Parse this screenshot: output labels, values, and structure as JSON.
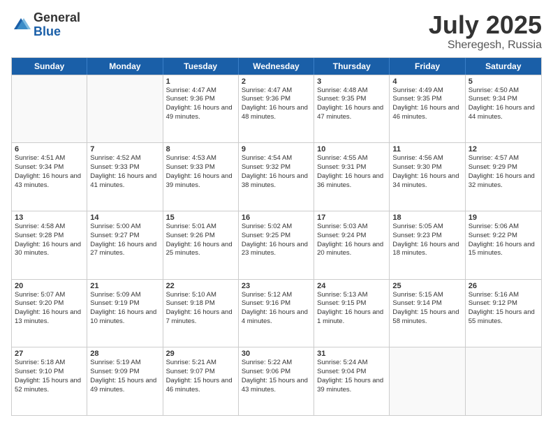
{
  "logo": {
    "general": "General",
    "blue": "Blue"
  },
  "title": "July 2025",
  "subtitle": "Sheregesh, Russia",
  "header_days": [
    "Sunday",
    "Monday",
    "Tuesday",
    "Wednesday",
    "Thursday",
    "Friday",
    "Saturday"
  ],
  "weeks": [
    [
      {
        "day": "",
        "empty": true
      },
      {
        "day": "",
        "empty": true
      },
      {
        "day": "1",
        "sunrise": "Sunrise: 4:47 AM",
        "sunset": "Sunset: 9:36 PM",
        "daylight": "Daylight: 16 hours and 49 minutes."
      },
      {
        "day": "2",
        "sunrise": "Sunrise: 4:47 AM",
        "sunset": "Sunset: 9:36 PM",
        "daylight": "Daylight: 16 hours and 48 minutes."
      },
      {
        "day": "3",
        "sunrise": "Sunrise: 4:48 AM",
        "sunset": "Sunset: 9:35 PM",
        "daylight": "Daylight: 16 hours and 47 minutes."
      },
      {
        "day": "4",
        "sunrise": "Sunrise: 4:49 AM",
        "sunset": "Sunset: 9:35 PM",
        "daylight": "Daylight: 16 hours and 46 minutes."
      },
      {
        "day": "5",
        "sunrise": "Sunrise: 4:50 AM",
        "sunset": "Sunset: 9:34 PM",
        "daylight": "Daylight: 16 hours and 44 minutes."
      }
    ],
    [
      {
        "day": "6",
        "sunrise": "Sunrise: 4:51 AM",
        "sunset": "Sunset: 9:34 PM",
        "daylight": "Daylight: 16 hours and 43 minutes."
      },
      {
        "day": "7",
        "sunrise": "Sunrise: 4:52 AM",
        "sunset": "Sunset: 9:33 PM",
        "daylight": "Daylight: 16 hours and 41 minutes."
      },
      {
        "day": "8",
        "sunrise": "Sunrise: 4:53 AM",
        "sunset": "Sunset: 9:33 PM",
        "daylight": "Daylight: 16 hours and 39 minutes."
      },
      {
        "day": "9",
        "sunrise": "Sunrise: 4:54 AM",
        "sunset": "Sunset: 9:32 PM",
        "daylight": "Daylight: 16 hours and 38 minutes."
      },
      {
        "day": "10",
        "sunrise": "Sunrise: 4:55 AM",
        "sunset": "Sunset: 9:31 PM",
        "daylight": "Daylight: 16 hours and 36 minutes."
      },
      {
        "day": "11",
        "sunrise": "Sunrise: 4:56 AM",
        "sunset": "Sunset: 9:30 PM",
        "daylight": "Daylight: 16 hours and 34 minutes."
      },
      {
        "day": "12",
        "sunrise": "Sunrise: 4:57 AM",
        "sunset": "Sunset: 9:29 PM",
        "daylight": "Daylight: 16 hours and 32 minutes."
      }
    ],
    [
      {
        "day": "13",
        "sunrise": "Sunrise: 4:58 AM",
        "sunset": "Sunset: 9:28 PM",
        "daylight": "Daylight: 16 hours and 30 minutes."
      },
      {
        "day": "14",
        "sunrise": "Sunrise: 5:00 AM",
        "sunset": "Sunset: 9:27 PM",
        "daylight": "Daylight: 16 hours and 27 minutes."
      },
      {
        "day": "15",
        "sunrise": "Sunrise: 5:01 AM",
        "sunset": "Sunset: 9:26 PM",
        "daylight": "Daylight: 16 hours and 25 minutes."
      },
      {
        "day": "16",
        "sunrise": "Sunrise: 5:02 AM",
        "sunset": "Sunset: 9:25 PM",
        "daylight": "Daylight: 16 hours and 23 minutes."
      },
      {
        "day": "17",
        "sunrise": "Sunrise: 5:03 AM",
        "sunset": "Sunset: 9:24 PM",
        "daylight": "Daylight: 16 hours and 20 minutes."
      },
      {
        "day": "18",
        "sunrise": "Sunrise: 5:05 AM",
        "sunset": "Sunset: 9:23 PM",
        "daylight": "Daylight: 16 hours and 18 minutes."
      },
      {
        "day": "19",
        "sunrise": "Sunrise: 5:06 AM",
        "sunset": "Sunset: 9:22 PM",
        "daylight": "Daylight: 16 hours and 15 minutes."
      }
    ],
    [
      {
        "day": "20",
        "sunrise": "Sunrise: 5:07 AM",
        "sunset": "Sunset: 9:20 PM",
        "daylight": "Daylight: 16 hours and 13 minutes."
      },
      {
        "day": "21",
        "sunrise": "Sunrise: 5:09 AM",
        "sunset": "Sunset: 9:19 PM",
        "daylight": "Daylight: 16 hours and 10 minutes."
      },
      {
        "day": "22",
        "sunrise": "Sunrise: 5:10 AM",
        "sunset": "Sunset: 9:18 PM",
        "daylight": "Daylight: 16 hours and 7 minutes."
      },
      {
        "day": "23",
        "sunrise": "Sunrise: 5:12 AM",
        "sunset": "Sunset: 9:16 PM",
        "daylight": "Daylight: 16 hours and 4 minutes."
      },
      {
        "day": "24",
        "sunrise": "Sunrise: 5:13 AM",
        "sunset": "Sunset: 9:15 PM",
        "daylight": "Daylight: 16 hours and 1 minute."
      },
      {
        "day": "25",
        "sunrise": "Sunrise: 5:15 AM",
        "sunset": "Sunset: 9:14 PM",
        "daylight": "Daylight: 15 hours and 58 minutes."
      },
      {
        "day": "26",
        "sunrise": "Sunrise: 5:16 AM",
        "sunset": "Sunset: 9:12 PM",
        "daylight": "Daylight: 15 hours and 55 minutes."
      }
    ],
    [
      {
        "day": "27",
        "sunrise": "Sunrise: 5:18 AM",
        "sunset": "Sunset: 9:10 PM",
        "daylight": "Daylight: 15 hours and 52 minutes."
      },
      {
        "day": "28",
        "sunrise": "Sunrise: 5:19 AM",
        "sunset": "Sunset: 9:09 PM",
        "daylight": "Daylight: 15 hours and 49 minutes."
      },
      {
        "day": "29",
        "sunrise": "Sunrise: 5:21 AM",
        "sunset": "Sunset: 9:07 PM",
        "daylight": "Daylight: 15 hours and 46 minutes."
      },
      {
        "day": "30",
        "sunrise": "Sunrise: 5:22 AM",
        "sunset": "Sunset: 9:06 PM",
        "daylight": "Daylight: 15 hours and 43 minutes."
      },
      {
        "day": "31",
        "sunrise": "Sunrise: 5:24 AM",
        "sunset": "Sunset: 9:04 PM",
        "daylight": "Daylight: 15 hours and 39 minutes."
      },
      {
        "day": "",
        "empty": true
      },
      {
        "day": "",
        "empty": true
      }
    ]
  ]
}
